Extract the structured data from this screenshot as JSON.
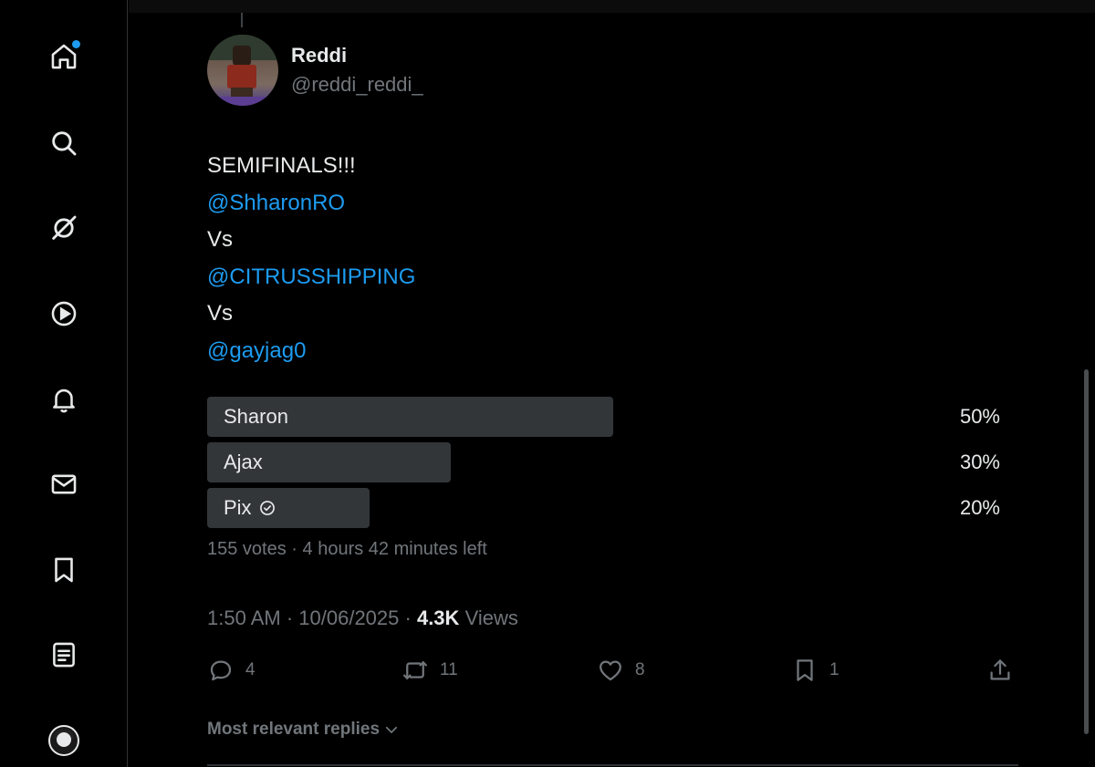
{
  "sidebar": {
    "items": [
      {
        "name": "home",
        "icon": "home-icon",
        "has_notification_dot": true
      },
      {
        "name": "explore",
        "icon": "search-icon"
      },
      {
        "name": "grok",
        "icon": "grok-icon"
      },
      {
        "name": "videos",
        "icon": "play-icon"
      },
      {
        "name": "notifications",
        "icon": "bell-icon"
      },
      {
        "name": "messages",
        "icon": "mail-icon"
      },
      {
        "name": "bookmarks",
        "icon": "bookmark-icon"
      },
      {
        "name": "lists",
        "icon": "list-icon"
      },
      {
        "name": "profile",
        "icon": "profile-avatar"
      }
    ],
    "accent_color": "#1d9bf0"
  },
  "post": {
    "author": {
      "display_name": "Reddi",
      "handle": "@reddi_reddi_"
    },
    "lines": [
      {
        "text": "SEMIFINALS!!!",
        "mention": false
      },
      {
        "text": "@ShharonRO",
        "mention": true
      },
      {
        "text": "Vs",
        "mention": false
      },
      {
        "text": "@CITRUSSHIPPING",
        "mention": true
      },
      {
        "text": "Vs",
        "mention": false
      },
      {
        "text": "@gayjag0",
        "mention": true
      }
    ],
    "poll": {
      "options": [
        {
          "label": "Sharon",
          "percent_text": "50%",
          "fraction": 0.5,
          "voted": false
        },
        {
          "label": "Ajax",
          "percent_text": "30%",
          "fraction": 0.3,
          "voted": false
        },
        {
          "label": "Pix",
          "percent_text": "20%",
          "fraction": 0.2,
          "voted": true
        }
      ],
      "votes_text": "155 votes",
      "separator": " · ",
      "time_left": "4 hours 42 minutes left"
    },
    "time": "1:50 AM",
    "date": "10/06/2025",
    "views_count": "4.3K",
    "views_label": "Views",
    "actions": {
      "replies": "4",
      "reposts": "11",
      "likes": "8",
      "bookmarks": "1"
    }
  },
  "replies_sort_label": "Most relevant replies",
  "colors": {
    "background": "#000000",
    "text": "#e7e9ea",
    "muted": "#71767b",
    "link": "#1d9bf0",
    "poll_bar": "#333639"
  }
}
